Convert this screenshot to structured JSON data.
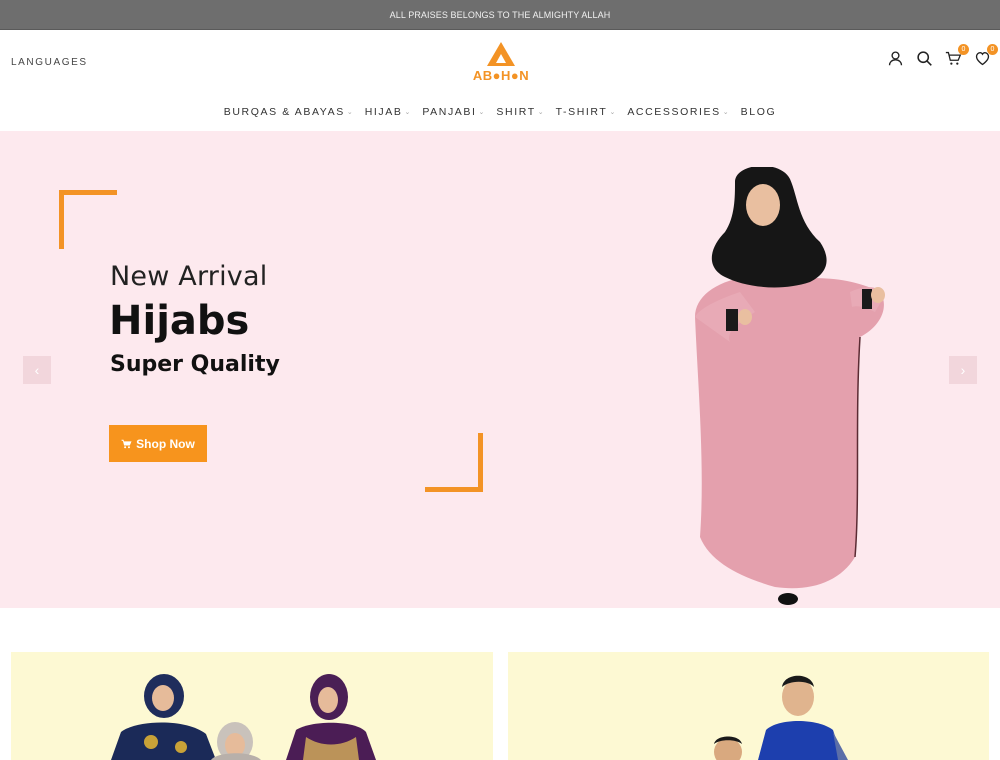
{
  "topbar": {
    "text": "ALL PRAISES BELONGS TO THE ALMIGHTY ALLAH"
  },
  "header": {
    "languages_label": "LANGUAGES",
    "logo_text": "AB●H●N",
    "cart_count": "0",
    "wishlist_count": "0"
  },
  "nav": {
    "items": [
      {
        "label": "BURQAS & ABAYAS",
        "has_dropdown": true
      },
      {
        "label": "HIJAB",
        "has_dropdown": true
      },
      {
        "label": "PANJABI",
        "has_dropdown": true
      },
      {
        "label": "SHIRT",
        "has_dropdown": true
      },
      {
        "label": "T-SHIRT",
        "has_dropdown": true
      },
      {
        "label": "ACCESSORIES",
        "has_dropdown": true
      },
      {
        "label": "BLOG",
        "has_dropdown": false
      }
    ]
  },
  "hero": {
    "subtitle": "New Arrival",
    "title": "Hijabs",
    "tagline": "Super Quality",
    "button_label": "Shop Now",
    "button_icon": "cart-icon",
    "prev_arrow": "‹",
    "next_arrow": "›"
  },
  "colors": {
    "accent": "#f39325",
    "hero_bg": "#fde9ee",
    "banner_bg": "#fdf9d3",
    "topbar_bg": "#6e6e6e"
  }
}
